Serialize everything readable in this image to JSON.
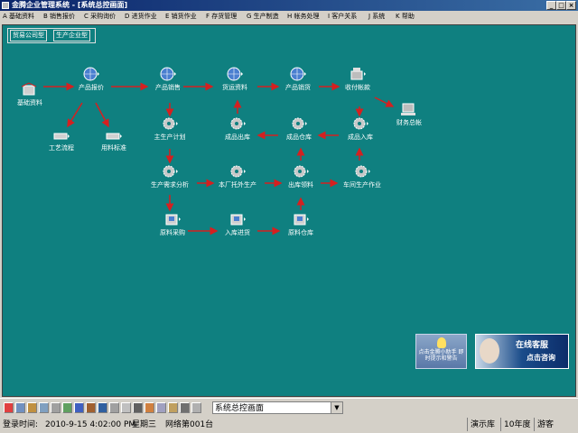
{
  "window": {
    "title": "金腾企业管理系统 - [系统总控画面]",
    "controls": [
      "_",
      "□",
      "×"
    ]
  },
  "menu": [
    "A 基础资料",
    "B 销售报价",
    "C 采购询价",
    "D 进货作业",
    "E 销货作业",
    "F 存货管理",
    "G 生产制造",
    "H 帐务处理",
    "I 客户关系",
    "J 系统",
    "K 帮助"
  ],
  "tabs": [
    "贸易公司型",
    "生产企业型"
  ],
  "colors": {
    "canvas": "#0f8080",
    "arrow": "#d42020",
    "titlebar": "#0a246a"
  },
  "nodes": {
    "jichu": "基础资料",
    "chanpin_baojia": "产品报价",
    "chanpin_xiaoshou": "产品销售",
    "huoyun": "货运资料",
    "chanpin_xiaohuo": "产品销货",
    "shoufu": "收付帐款",
    "gongyi": "工艺流程",
    "yongliao": "用料标准",
    "zhu_jihua": "主生产计划",
    "chengpin_chuku": "成品出库",
    "chengpin_cangku": "成品仓库",
    "chengpin_ruku": "成品入库",
    "caiwu": "财务总帐",
    "xuqiu": "生产需求分析",
    "benchang": "本厂托外生产",
    "chuku_lingliao": "出库领料",
    "chejian": "车间生产作业",
    "yuanliao_caigou": "原料采购",
    "ruku_jinhuo": "入库进货",
    "yuanliao_cangku": "原料仓库"
  },
  "promo": {
    "left": "点击金腾小助手 即时提示和警告",
    "right_title": "在线客服",
    "right_sub": "点击咨询"
  },
  "toolbar_select": "系统总控画面",
  "status": {
    "login_label": "登录时间:",
    "login_time": "2010-9-15 4:02:00 PM",
    "weekday": "星期三",
    "network": "网络第001台",
    "db": "演示库",
    "year": "10年度",
    "user": "游客"
  }
}
